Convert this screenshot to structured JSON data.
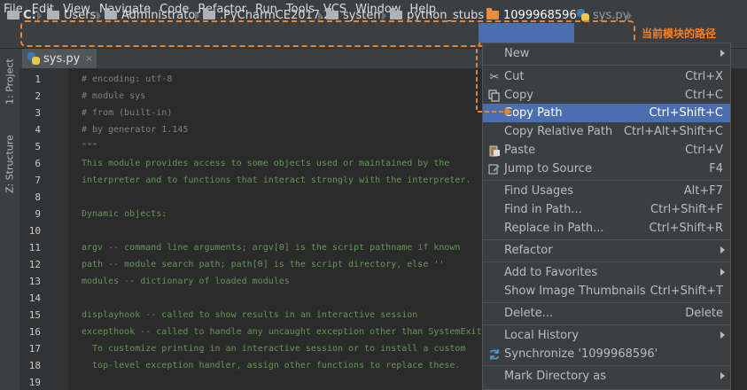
{
  "menubar": {
    "items": [
      "File",
      "Edit",
      "View",
      "Navigate",
      "Code",
      "Refactor",
      "Run",
      "Tools",
      "VCS",
      "Window",
      "Help"
    ]
  },
  "breadcrumb": {
    "items": [
      "C:",
      "Users",
      "Administrator",
      ".PyCharmCE2017.2",
      "system",
      "python_stubs",
      "1099968596",
      "sys.py"
    ],
    "selected": "1099968596"
  },
  "annotation": "当前模块的路径",
  "toolstrip": {
    "project_tab": "1: Project",
    "structure_tab": "Z: Structure"
  },
  "editor_tab": {
    "label": "sys.py",
    "close": "×"
  },
  "line_numbers": [
    "1",
    "2",
    "3",
    "4",
    "5",
    "6",
    "7",
    "8",
    "9",
    "10",
    "11",
    "12",
    "13",
    "14",
    "15",
    "16",
    "17",
    "18",
    "19"
  ],
  "code_lines": [
    "# encoding: utf-8",
    "# module sys",
    "# from (built-in)",
    "# by generator 1.145",
    "\"\"\"",
    "This module provides access to some objects used or maintained by the",
    "interpreter and to functions that interact strongly with the interpreter.",
    "",
    "Dynamic objects:",
    "",
    "argv -- command line arguments; argv[0] is the script pathname if known",
    "path -- module search path; path[0] is the script directory, else ''",
    "modules -- dictionary of loaded modules",
    "",
    "displayhook -- called to show results in an interactive session",
    "excepthook -- called to handle any uncaught exception other than SystemExit",
    "  To customize printing in an interactive session or to install a custom",
    "  top-level exception handler, assign other functions to replace these.",
    ""
  ],
  "context_menu": {
    "items": [
      {
        "label": "New",
        "shortcut": "",
        "submenu": true
      },
      {
        "label": "Cut",
        "shortcut": "Ctrl+X",
        "icon": "scissors-icon"
      },
      {
        "label": "Copy",
        "shortcut": "Ctrl+C",
        "icon": "copy-icon"
      },
      {
        "label": "Copy Path",
        "shortcut": "Ctrl+Shift+C",
        "selected": true
      },
      {
        "label": "Copy Relative Path",
        "shortcut": "Ctrl+Alt+Shift+C"
      },
      {
        "label": "Paste",
        "shortcut": "Ctrl+V",
        "icon": "paste-icon"
      },
      {
        "label": "Jump to Source",
        "shortcut": "F4",
        "icon": "jump-source-icon"
      },
      {
        "label": "Find Usages",
        "shortcut": "Alt+F7"
      },
      {
        "label": "Find in Path...",
        "shortcut": "Ctrl+Shift+F"
      },
      {
        "label": "Replace in Path...",
        "shortcut": "Ctrl+Shift+R"
      },
      {
        "label": "Refactor",
        "shortcut": "",
        "submenu": true
      },
      {
        "label": "Add to Favorites",
        "shortcut": "",
        "submenu": true
      },
      {
        "label": "Show Image Thumbnails",
        "shortcut": "Ctrl+Shift+T"
      },
      {
        "label": "Delete...",
        "shortcut": "Delete"
      },
      {
        "label": "Local History",
        "shortcut": "",
        "submenu": true
      },
      {
        "label": "Synchronize '1099968596'",
        "shortcut": "",
        "icon": "sync-icon"
      },
      {
        "label": "Mark Directory as",
        "shortcut": "",
        "submenu": true
      }
    ]
  },
  "colors": {
    "accent": "#4b6eaf",
    "annotation": "#ff7f1e",
    "docstring": "#629755",
    "comment": "#808080"
  }
}
